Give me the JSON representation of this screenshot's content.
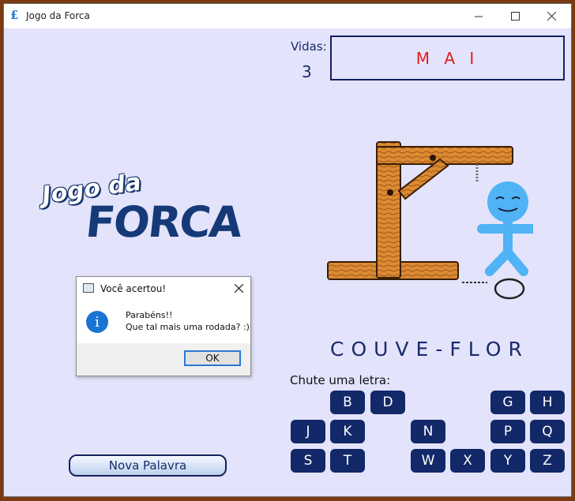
{
  "window": {
    "title": "Jogo da Forca",
    "app_icon": "£"
  },
  "game": {
    "vidas_label": "Vidas:",
    "vidas": "3",
    "used_letters": "M A I",
    "word": "COUVE-FLOR",
    "chute_label": "Chute uma letra:",
    "new_word_button": "Nova Palavra"
  },
  "logo": {
    "top": "Jogo da",
    "main": "FORCA"
  },
  "keys": [
    "B",
    "D",
    "G",
    "H",
    "J",
    "K",
    "N",
    "P",
    "Q",
    "S",
    "T",
    "W",
    "X",
    "Y",
    "Z"
  ],
  "dialog": {
    "title": "Você acertou!",
    "line1": "Parabéns!!",
    "line2": "Que tal mais uma rodada? :)",
    "ok": "OK"
  },
  "colors": {
    "background": "#e3e3fb",
    "key": "#122868",
    "used_letters": "#e01b1b",
    "figure": "#4fb3f5",
    "wood": "#d9822b"
  }
}
